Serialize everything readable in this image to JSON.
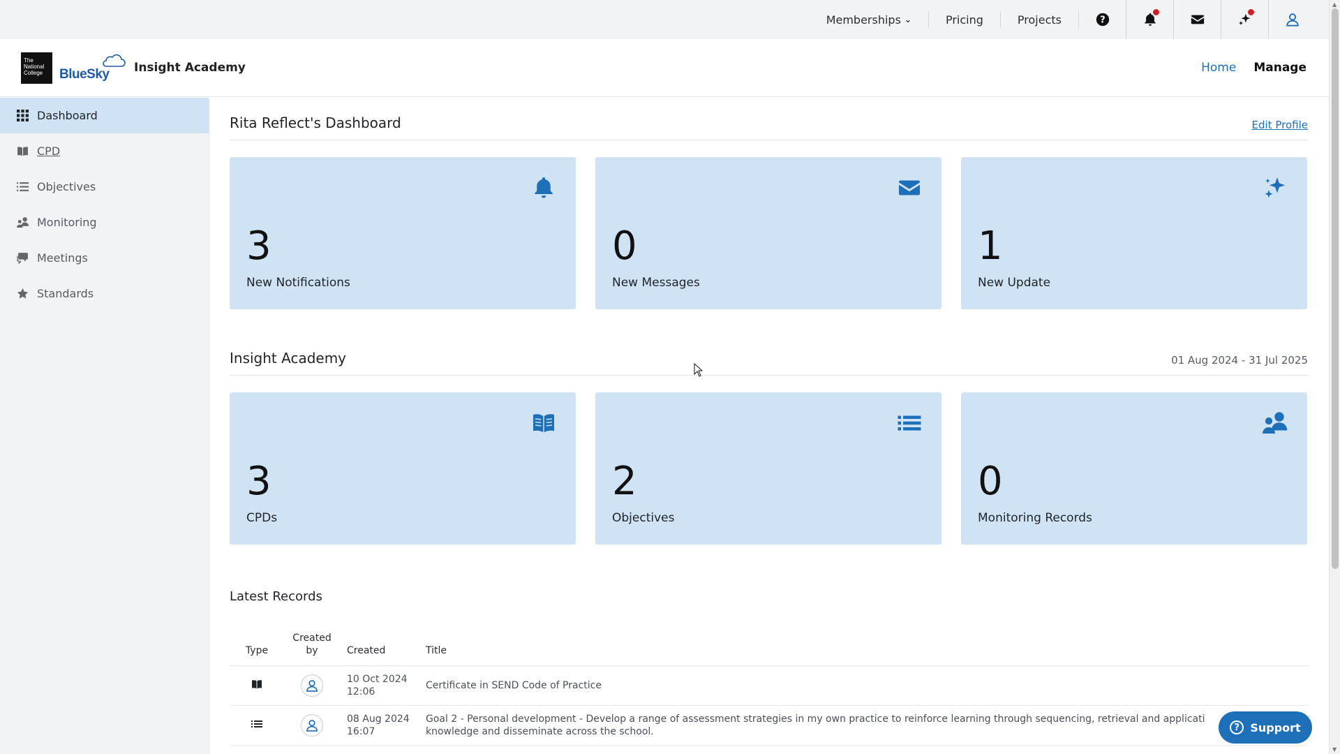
{
  "topbar": {
    "memberships": "Memberships",
    "pricing": "Pricing",
    "projects": "Projects"
  },
  "header": {
    "logo_text": "The National College",
    "brand": "BlueSky",
    "app_title": "Insight Academy",
    "nav": {
      "home": "Home",
      "manage": "Manage"
    }
  },
  "sidebar": {
    "items": [
      {
        "label": "Dashboard",
        "icon": "grid-icon"
      },
      {
        "label": "CPD",
        "icon": "book-icon"
      },
      {
        "label": "Objectives",
        "icon": "list-icon"
      },
      {
        "label": "Monitoring",
        "icon": "users-icon"
      },
      {
        "label": "Meetings",
        "icon": "comments-icon"
      },
      {
        "label": "Standards",
        "icon": "star-icon"
      }
    ]
  },
  "dashboard": {
    "title": "Rita Reflect's Dashboard",
    "edit_profile": "Edit Profile",
    "cards": [
      {
        "value": "3",
        "label": "New Notifications",
        "icon": "bell-icon"
      },
      {
        "value": "0",
        "label": "New Messages",
        "icon": "envelope-icon"
      },
      {
        "value": "1",
        "label": "New Update",
        "icon": "sparkles-icon"
      }
    ]
  },
  "academy": {
    "title": "Insight Academy",
    "date_range": "01 Aug 2024 - 31 Jul 2025",
    "cards": [
      {
        "value": "3",
        "label": "CPDs",
        "icon": "book-icon"
      },
      {
        "value": "2",
        "label": "Objectives",
        "icon": "list-icon"
      },
      {
        "value": "0",
        "label": "Monitoring Records",
        "icon": "users-icon"
      }
    ]
  },
  "latest": {
    "title": "Latest Records",
    "columns": {
      "type": "Type",
      "created_by_1": "Created",
      "created_by_2": "by",
      "created": "Created",
      "title": "Title"
    },
    "rows": [
      {
        "type_icon": "book-icon",
        "date": "10 Oct 2024",
        "time": "12:06",
        "title": "Certificate in SEND Code of Practice"
      },
      {
        "type_icon": "list-icon",
        "date": "08 Aug 2024",
        "time": "16:07",
        "title": "Goal 2 - Personal development - Develop a range of assessment strategies in my own practice to reinforce learning through sequencing, retrieval and applicati",
        "title_2": "knowledge and disseminate across the school."
      }
    ]
  },
  "support": {
    "label": "Support"
  },
  "colors": {
    "accent": "#1d6fb8",
    "card_bg": "#cfe3f5",
    "badge": "#c8222a"
  }
}
